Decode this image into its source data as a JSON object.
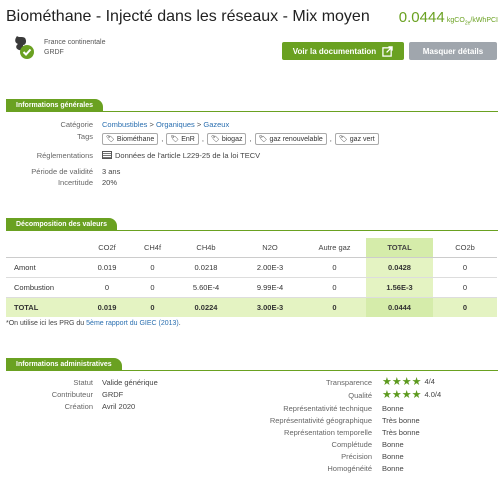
{
  "header": {
    "title": "Biométhane - Injecté dans les réseaux - Mix moyen",
    "value": "0.0444",
    "unit_prefix": "kgCO",
    "unit_sub": "2e",
    "unit_suffix": "/kWhPCI"
  },
  "source": {
    "region": "France continentale",
    "org": "GRDF"
  },
  "buttons": {
    "doc_label": "Voir la documentation",
    "hide_label": "Masquer détails"
  },
  "colors": {
    "accent": "#6aa121",
    "grey_button": "#a0a6ad",
    "link": "#2a6fb0",
    "total_bg": "#e4f3c2"
  },
  "general": {
    "section_title": "Informations générales",
    "category_label": "Catégorie",
    "category_path": [
      "Combustibles",
      "Organiques",
      "Gazeux"
    ],
    "category_sep": ">",
    "tags_label": "Tags",
    "tags": [
      "Biométhane",
      "EnR",
      "biogaz",
      "gaz renouvelable",
      "gaz vert"
    ],
    "tag_separator": ",",
    "tag_icon": "tag-icon",
    "regulations_label": "Réglementations",
    "regulation_text": "Données de l'article L229-25 de la loi TECV",
    "validity_label": "Période de validité",
    "validity_value": "3 ans",
    "uncertainty_label": "Incertitude",
    "uncertainty_value": "20%"
  },
  "decomposition": {
    "section_title": "Décomposition des valeurs",
    "columns": [
      "",
      "CO2f",
      "CH4f",
      "CH4b",
      "N2O",
      "Autre gaz",
      "TOTAL",
      "CO2b"
    ],
    "rows": [
      [
        "Amont",
        "0.019",
        "0",
        "0.0218",
        "2.00E-3",
        "0",
        "0.0428",
        "0"
      ],
      [
        "Combustion",
        "0",
        "0",
        "5.60E-4",
        "9.99E-4",
        "0",
        "1.56E-3",
        "0"
      ]
    ],
    "total_row": [
      "TOTAL",
      "0.019",
      "0",
      "0.0224",
      "3.00E-3",
      "0",
      "0.0444",
      "0"
    ],
    "footnote_prefix": "*On utilise ici les PRG du ",
    "footnote_link": "5ème rapport du GIEC (2013)",
    "footnote_suffix": "."
  },
  "admin": {
    "section_title": "Informations administratives",
    "status_label": "Statut",
    "status_value": "Valide générique",
    "contributor_label": "Contributeur",
    "contributor_value": "GRDF",
    "creation_label": "Création",
    "creation_value": "Avril 2020",
    "transparency_label": "Transparence",
    "transparency_stars": "★★★★",
    "transparency_value": "4/4",
    "quality_label": "Qualité",
    "quality_stars": "★★★★",
    "quality_value": "4.0/4",
    "rep_tech_label": "Représentativité technique",
    "rep_tech_value": "Bonne",
    "rep_geo_label": "Représentativité géographique",
    "rep_geo_value": "Très bonne",
    "rep_temp_label": "Représentation temporelle",
    "rep_temp_value": "Très bonne",
    "completeness_label": "Complétude",
    "completeness_value": "Bonne",
    "precision_label": "Précision",
    "precision_value": "Bonne",
    "homogeneity_label": "Homogénéité",
    "homogeneity_value": "Bonne"
  }
}
